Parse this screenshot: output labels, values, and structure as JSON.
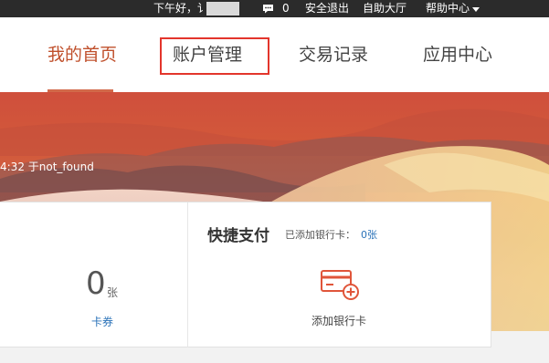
{
  "topbar": {
    "greeting": "下午好，讠",
    "message_count": "0",
    "logout": "安全退出",
    "self_service_hall": "自助大厅",
    "help_center": "帮助中心"
  },
  "nav": {
    "home": "我的首页",
    "account": "账户管理",
    "transactions": "交易记录",
    "apps": "应用中心"
  },
  "hero": {
    "login_caption": "4:32 于not_found"
  },
  "coupons": {
    "count": "0",
    "unit": "张",
    "link": "卡券"
  },
  "quick_pay": {
    "title": "快捷支付",
    "bank_card_label": "已添加银行卡：",
    "bank_card_count": "0张",
    "add_card": "添加银行卡"
  },
  "colors": {
    "accent": "#c0502c",
    "highlight_box": "#e3352c",
    "link": "#2a72b8"
  }
}
